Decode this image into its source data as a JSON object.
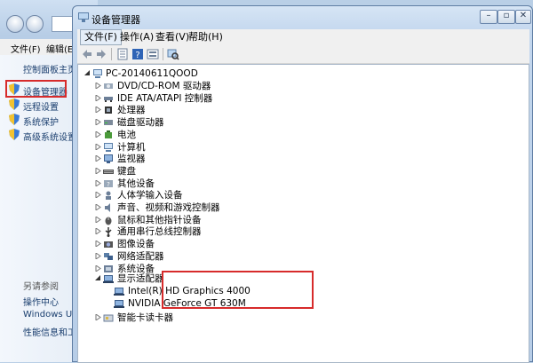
{
  "background_window": {
    "menu": [
      "文件(F)",
      "编辑(E"
    ],
    "links": [
      {
        "label": "控制面板主页",
        "icon": "none"
      },
      {
        "label": "设备管理器",
        "icon": "shield-icon"
      },
      {
        "label": "远程设置",
        "icon": "shield-icon"
      },
      {
        "label": "系统保护",
        "icon": "shield-icon"
      },
      {
        "label": "高级系统设置",
        "icon": "shield-icon"
      }
    ],
    "see_also": {
      "heading": "另请参阅",
      "links": [
        "操作中心",
        "Windows Upc",
        "性能信息和工"
      ]
    }
  },
  "device_manager": {
    "title": "设备管理器",
    "menu": [
      "文件(F)",
      "操作(A)",
      "查看(V)",
      "帮助(H)"
    ],
    "root": "PC-20140611QOOD",
    "categories": [
      {
        "label": "DVD/CD-ROM 驱动器",
        "icon": "disc-drive-icon"
      },
      {
        "label": "IDE ATA/ATAPI 控制器",
        "icon": "ide-controller-icon"
      },
      {
        "label": "处理器",
        "icon": "processor-icon"
      },
      {
        "label": "磁盘驱动器",
        "icon": "disk-drive-icon"
      },
      {
        "label": "电池",
        "icon": "battery-icon"
      },
      {
        "label": "计算机",
        "icon": "computer-icon"
      },
      {
        "label": "监视器",
        "icon": "monitor-icon"
      },
      {
        "label": "键盘",
        "icon": "keyboard-icon"
      },
      {
        "label": "其他设备",
        "icon": "other-devices-icon"
      },
      {
        "label": "人体学输入设备",
        "icon": "hid-icon"
      },
      {
        "label": "声音、视频和游戏控制器",
        "icon": "sound-icon"
      },
      {
        "label": "鼠标和其他指针设备",
        "icon": "mouse-icon"
      },
      {
        "label": "通用串行总线控制器",
        "icon": "usb-icon"
      },
      {
        "label": "图像设备",
        "icon": "camera-icon"
      },
      {
        "label": "网络适配器",
        "icon": "network-icon"
      },
      {
        "label": "系统设备",
        "icon": "system-devices-icon"
      }
    ],
    "display_adapters": {
      "label": "显示适配器",
      "children": [
        "Intel(R) HD Graphics 4000",
        "NVIDIA GeForce GT 630M"
      ]
    },
    "last_category": "智能卡读卡器"
  },
  "colors": {
    "highlight_border": "#d72b2b",
    "link_text": "#1a3e6e"
  }
}
